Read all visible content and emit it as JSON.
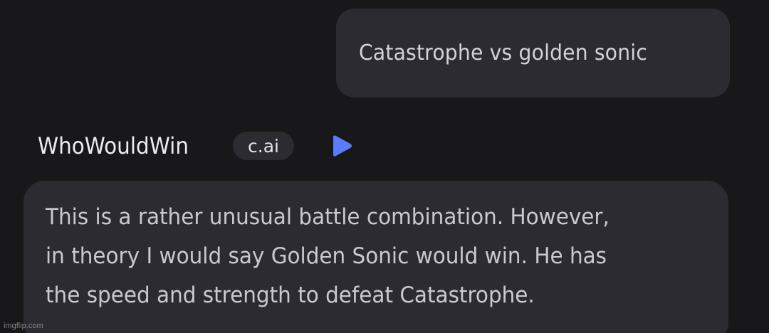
{
  "user_message": {
    "text": "Catastrophe vs golden sonic"
  },
  "character": {
    "name": "WhoWouldWin",
    "badge": "c.ai",
    "play_icon": "play-icon",
    "accent_color": "#5b7cfa"
  },
  "bot_message": {
    "lines": [
      "This is a rather unusual battle combination. However,",
      "in theory I would say Golden Sonic would win. He has",
      "the speed and strength to defeat Catastrophe."
    ]
  },
  "watermark": "imgflip.com"
}
